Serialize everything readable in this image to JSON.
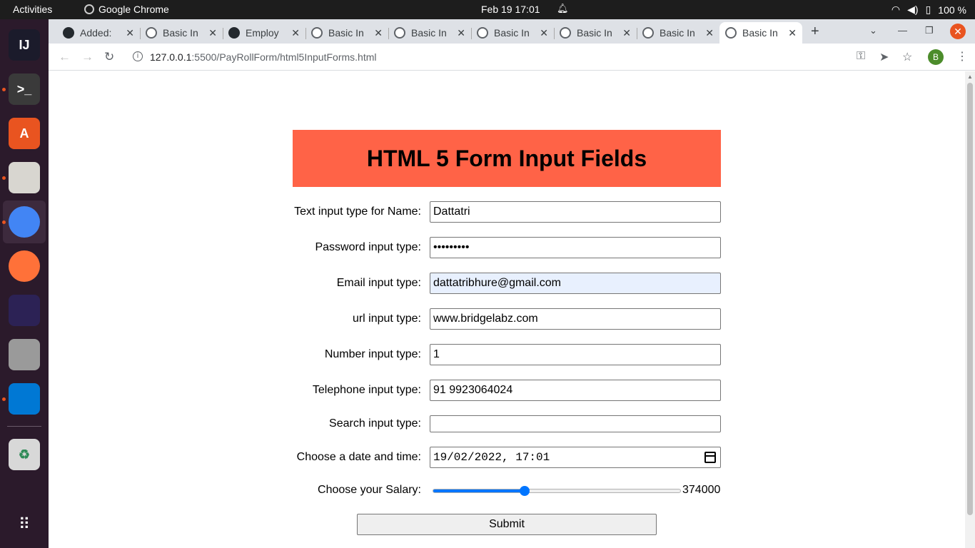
{
  "topbar": {
    "activities": "Activities",
    "app_name": "Google Chrome",
    "datetime": "Feb 19  17:01",
    "battery": "100 %"
  },
  "dock": {
    "items": [
      {
        "name": "intellij-icon",
        "label": "IJ",
        "color": "#1b1b2b"
      },
      {
        "name": "terminal-icon",
        "label": ">_",
        "color": "#3a3a3a"
      },
      {
        "name": "software-center-icon",
        "label": "A",
        "color": "#e95420"
      },
      {
        "name": "files-icon",
        "label": "",
        "color": "#d8d6d0"
      },
      {
        "name": "chrome-icon",
        "label": "",
        "color": "#4285f4"
      },
      {
        "name": "firefox-icon",
        "label": "",
        "color": "#ff7139"
      },
      {
        "name": "eclipse-icon",
        "label": "",
        "color": "#2c2255"
      },
      {
        "name": "image-viewer-icon",
        "label": "",
        "color": "#9a9a9a"
      },
      {
        "name": "vscode-icon",
        "label": "",
        "color": "#0078d4"
      },
      {
        "name": "trash-icon",
        "label": "♻",
        "color": "#d8d8d8"
      }
    ]
  },
  "tabs": [
    {
      "label": "Added:",
      "icon": "github-icon"
    },
    {
      "label": "Basic In",
      "icon": "globe-icon"
    },
    {
      "label": "Employ",
      "icon": "github-icon"
    },
    {
      "label": "Basic In",
      "icon": "globe-icon"
    },
    {
      "label": "Basic In",
      "icon": "globe-icon"
    },
    {
      "label": "Basic In",
      "icon": "globe-icon"
    },
    {
      "label": "Basic In",
      "icon": "globe-icon"
    },
    {
      "label": "Basic In",
      "icon": "globe-icon"
    },
    {
      "label": "Basic In",
      "icon": "globe-icon"
    }
  ],
  "address": {
    "host": "127.0.0.1",
    "path": ":5500/PayRollForm/html5InputForms.html"
  },
  "profile_initial": "B",
  "form": {
    "title": "HTML 5 Form Input Fields",
    "fields": {
      "name": {
        "label": "Text input type for Name:",
        "value": "Dattatri"
      },
      "password": {
        "label": "Password input type:",
        "value": "•••••••••"
      },
      "email": {
        "label": "Email input type:",
        "value": "dattatribhure@gmail.com"
      },
      "url": {
        "label": "url input type:",
        "value": "www.bridgelabz.com"
      },
      "number": {
        "label": "Number input type:",
        "value": "1"
      },
      "telephone": {
        "label": "Telephone input type:",
        "value": "91 9923064024"
      },
      "search": {
        "label": "Search input type:",
        "value": ""
      },
      "datetime": {
        "label": "Choose a date and time:",
        "value": "19/02/2022, 17:01"
      },
      "salary": {
        "label": "Choose your Salary:",
        "value": "374000",
        "fraction": 0.37
      }
    },
    "submit_label": "Submit"
  },
  "colors": {
    "header_bg": "#ff6347",
    "autofill_bg": "#e8f0fe",
    "slider_accent": "#0075ff",
    "ubuntu_orange": "#e95420"
  }
}
